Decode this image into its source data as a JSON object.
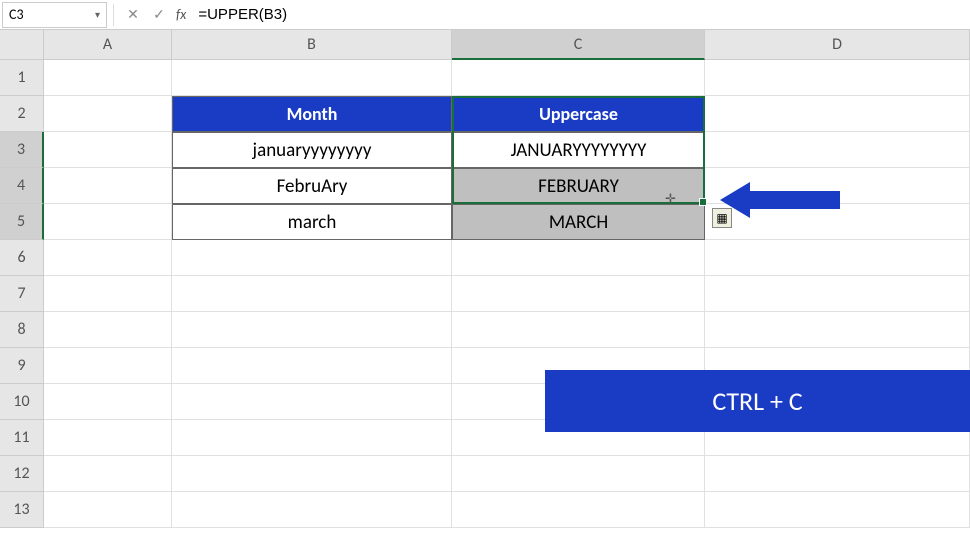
{
  "formula_bar": {
    "name_box": "C3",
    "fx_label": "fx",
    "formula": "=UPPER(B3)"
  },
  "columns": [
    "A",
    "B",
    "C",
    "D"
  ],
  "rows": [
    "1",
    "2",
    "3",
    "4",
    "5",
    "6",
    "7",
    "8",
    "9",
    "10",
    "11",
    "12",
    "13"
  ],
  "table": {
    "headers": {
      "month": "Month",
      "uppercase": "Uppercase"
    },
    "data": [
      {
        "month": "januaryyyyyyyy",
        "upper": "JANUARYYYYYYYY"
      },
      {
        "month": "FebruAry",
        "upper": "FEBRUARY"
      },
      {
        "month": "march",
        "upper": "MARCH"
      }
    ]
  },
  "callout": {
    "shortcut": "CTRL + C"
  },
  "selection": {
    "active_cell": "C3",
    "range": "C3:C5"
  },
  "chart_data": {
    "type": "table",
    "title": "",
    "columns": [
      "Month",
      "Uppercase"
    ],
    "rows": [
      [
        "januaryyyyyyyy",
        "JANUARYYYYYYYY"
      ],
      [
        "FebruAry",
        "FEBRUARY"
      ],
      [
        "march",
        "MARCH"
      ]
    ]
  }
}
